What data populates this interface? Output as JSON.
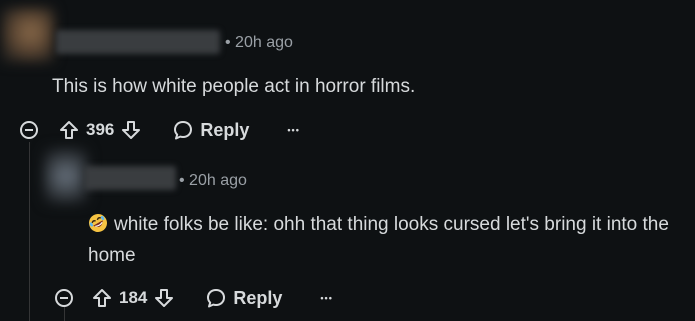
{
  "comments": [
    {
      "timestamp": "• 20h ago",
      "body": "This is how white people act in horror films.",
      "score": "396",
      "reply_label": "Reply",
      "more_label": "•••"
    },
    {
      "timestamp": "• 20h ago",
      "emoji": "rolling-on-floor-laughing",
      "body": "white folks be like: ohh that thing looks cursed let's bring it into the home",
      "score": "184",
      "reply_label": "Reply",
      "more_label": "•••"
    }
  ],
  "icons": {
    "collapse": "collapse-icon",
    "upvote": "upvote-icon",
    "downvote": "downvote-icon",
    "reply": "reply-icon",
    "more": "more-icon"
  },
  "colors": {
    "background": "#0e1113",
    "text": "#d7dadc",
    "meta": "#9aa0a6",
    "thread_line": "#343536"
  }
}
